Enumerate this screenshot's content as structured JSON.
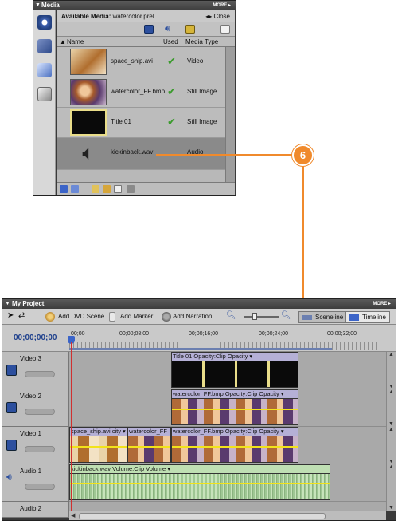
{
  "media_panel": {
    "title": "Media",
    "more": "MORE ▸",
    "available_label": "Available Media:",
    "available_value": "watercolor.prel",
    "close": "Close",
    "columns": {
      "name": "Name",
      "used": "Used",
      "media_type": "Media Type"
    },
    "items": [
      {
        "name": "space_ship.avi",
        "used": "✔",
        "type": "Video",
        "thumb": "video"
      },
      {
        "name": "watercolor_FF.bmp",
        "used": "✔",
        "type": "Still Image",
        "thumb": "image"
      },
      {
        "name": "Title 01",
        "used": "✔",
        "type": "Still Image",
        "thumb": "title"
      },
      {
        "name": "kickinback.wav",
        "used": "",
        "type": "Audio",
        "thumb": "audio",
        "selected": true
      }
    ]
  },
  "callout": {
    "number": "6",
    "color": "#f08a2c"
  },
  "project": {
    "title": "My Project",
    "more": "MORE ▸",
    "toolbar": {
      "add_dvd_scene": "Add DVD Scene",
      "add_marker": "Add Marker",
      "add_narration": "Add Narration",
      "sceneline": "Sceneline",
      "timeline": "Timeline"
    },
    "timecode": "00;00;00;00",
    "ruler_labels": [
      "00;00",
      "00;00;08;00",
      "00;00;16;00",
      "00;00;24;00",
      "00;00;32;00"
    ],
    "tracks": [
      {
        "name": "Video 3",
        "clips": [
          {
            "label": "Title 01  Opacity:Clip Opacity ▾"
          }
        ]
      },
      {
        "name": "Video 2",
        "clips": [
          {
            "label": "watercolor_FF.bmp  Opacity:Clip Opacity ▾"
          }
        ]
      },
      {
        "name": "Video 1",
        "clips": [
          {
            "label": "space_ship.avi  city ▾"
          },
          {
            "label": "watercolor_FF"
          },
          {
            "label": "watercolor_FF.bmp  Opacity:Clip Opacity ▾"
          }
        ]
      },
      {
        "name": "Audio 1",
        "clips": [
          {
            "label": "kickinback.wav  Volume:Clip Volume ▾"
          }
        ]
      },
      {
        "name": "Audio 2",
        "clips": []
      }
    ]
  }
}
